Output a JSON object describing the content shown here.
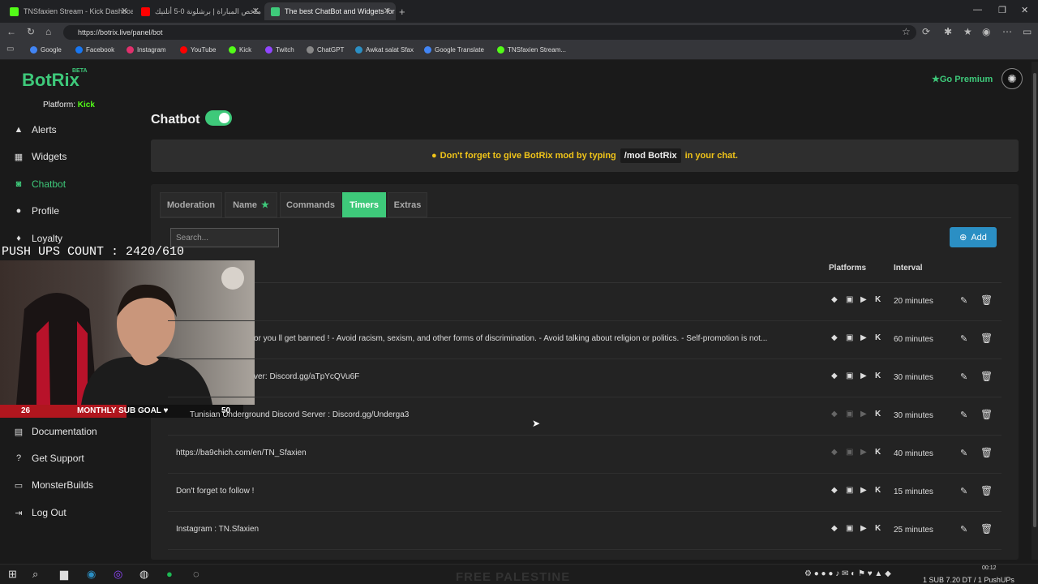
{
  "browser": {
    "tabs": [
      {
        "title": "TNSfaxien Stream - Kick Dashboard",
        "favicon_color": "#53fc18"
      },
      {
        "title": "ملخص المباراة | برشلونة 0-5 أتلتيك",
        "favicon_color": "#ff0000"
      },
      {
        "title": "The best ChatBot and Widgets for",
        "favicon_color": "#3ec97a"
      }
    ],
    "new_tab": "+",
    "url": "https://botrix.live/panel/bot",
    "bookmarks": [
      {
        "label": "Google",
        "color": "#4285f4"
      },
      {
        "label": "Facebook",
        "color": "#1877f2"
      },
      {
        "label": "Instagram",
        "color": "#e1306c"
      },
      {
        "label": "YouTube",
        "color": "#ff0000"
      },
      {
        "label": "Kick",
        "color": "#53fc18"
      },
      {
        "label": "Twitch",
        "color": "#9146ff"
      },
      {
        "label": "ChatGPT",
        "color": "#888888"
      },
      {
        "label": "Awkat salat Sfax",
        "color": "#2b8fc4"
      },
      {
        "label": "Google Translate",
        "color": "#4285f4"
      },
      {
        "label": "TNSfaxien Stream...",
        "color": "#53fc18"
      }
    ]
  },
  "app": {
    "logo": "BotRix",
    "beta": "BETA",
    "platform_label": "Platform:",
    "platform_value": "Kick",
    "go_premium": "Go Premium",
    "accent_color": "#3ec97a"
  },
  "sidebar": {
    "items": [
      {
        "label": "Alerts",
        "icon": "alert-icon"
      },
      {
        "label": "Widgets",
        "icon": "widgets-icon"
      },
      {
        "label": "Chatbot",
        "icon": "robot-icon",
        "active": true
      },
      {
        "label": "Profile",
        "icon": "profile-icon"
      },
      {
        "label": "Loyalty",
        "icon": "loyalty-icon"
      },
      {
        "label": "Documentation",
        "icon": "book-icon"
      },
      {
        "label": "Get Support",
        "icon": "support-icon"
      },
      {
        "label": "MonsterBuilds",
        "icon": "monitor-icon"
      },
      {
        "label": "Log Out",
        "icon": "logout-icon"
      }
    ]
  },
  "main": {
    "title": "Chatbot",
    "toggle_on": true,
    "notice": {
      "before": "Don't forget to give BotRix mod by typing",
      "command": "/mod BotRix",
      "after": "in your chat."
    },
    "tabs": [
      {
        "label": "Moderation"
      },
      {
        "label": "Name"
      },
      {
        "label": "Commands"
      },
      {
        "label": "Timers",
        "active": true
      },
      {
        "label": "Extras"
      }
    ],
    "search_placeholder": "Search...",
    "add_label": "Add",
    "columns": {
      "platforms": "Platforms",
      "interval": "Interval"
    },
    "timers": [
      {
        "message": "",
        "interval": "20 minutes",
        "platforms_active": true
      },
      {
        "message": "or you ll get banned ! - Avoid racism, sexism, and other forms of discrimination. - Avoid talking about religion or politics. - Self-promotion is not...",
        "interval": "60 minutes",
        "platforms_active": true
      },
      {
        "message": "ver: Discord.gg/aTpYcQVu6F",
        "interval": "30 minutes",
        "platforms_active": true
      },
      {
        "message": "Tunisian Underground Discord Server : Discord.gg/Underga3",
        "interval": "30 minutes",
        "platforms_active": false
      },
      {
        "message": "https://ba9chich.com/en/TN_Sfaxien",
        "interval": "40 minutes",
        "platforms_active": false
      },
      {
        "message": "Don't forget to follow !",
        "interval": "15 minutes",
        "platforms_active": true
      },
      {
        "message": "Instagram : TN.Sfaxien",
        "interval": "25 minutes",
        "platforms_active": true
      }
    ]
  },
  "overlay": {
    "pushups": "PUSH UPS COUNT : 2420/610",
    "sub_goal_current": "26",
    "sub_goal_label": "MONTHLY SUB GOAL",
    "sub_goal_target": "50",
    "sub_goal_fraction": 0.52,
    "watermark": "FREE PALESTINE",
    "tray_text": "1 SUB 7.20 DT / 1 PushUPs",
    "clock": "00:12"
  }
}
